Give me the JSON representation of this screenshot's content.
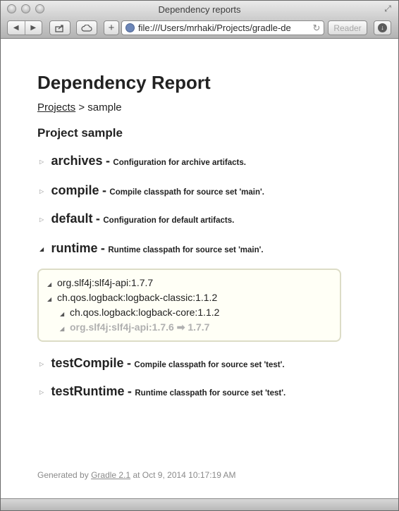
{
  "window": {
    "title": "Dependency reports",
    "url": "file:///Users/mrhaki/Projects/gradle-de",
    "reader_label": "Reader"
  },
  "report": {
    "heading": "Dependency Report",
    "breadcrumb": {
      "link": "Projects",
      "separator": ">",
      "current": "sample"
    },
    "project_heading": "Project sample",
    "configurations": [
      {
        "name": "archives",
        "dash": "-",
        "desc": "Configuration for archive artifacts.",
        "expanded": false
      },
      {
        "name": "compile",
        "dash": "-",
        "desc": "Compile classpath for source set 'main'.",
        "expanded": false
      },
      {
        "name": "default",
        "dash": "-",
        "desc": "Configuration for default artifacts.",
        "expanded": false
      },
      {
        "name": "runtime",
        "dash": "-",
        "desc": "Runtime classpath for source set 'main'.",
        "expanded": true
      },
      {
        "name": "testCompile",
        "dash": "-",
        "desc": "Compile classpath for source set 'test'.",
        "expanded": false
      },
      {
        "name": "testRuntime",
        "dash": "-",
        "desc": "Runtime classpath for source set 'test'.",
        "expanded": false
      }
    ],
    "runtime_dependencies": [
      {
        "text": "org.slf4j:slf4j-api:1.7.7",
        "conflict": false
      },
      {
        "text": "ch.qos.logback:logback-classic:1.1.2",
        "conflict": false
      },
      {
        "text": "ch.qos.logback:logback-core:1.1.2",
        "conflict": false
      },
      {
        "text": "org.slf4j:slf4j-api:1.7.6 ➡ 1.7.7",
        "conflict": true
      }
    ],
    "footer": {
      "prefix": "Generated by",
      "link": "Gradle 2.1",
      "suffix": "at Oct 9, 2014 10:17:19 AM"
    }
  },
  "icons": {
    "collapsed": "collapsed-triangle-icon",
    "expanded": "expanded-triangle-icon",
    "globe": "globe-icon",
    "reload": "reload-icon",
    "download": "download-icon",
    "share": "share-icon",
    "cloud": "cloud-icon",
    "add": "add-tab-icon"
  }
}
